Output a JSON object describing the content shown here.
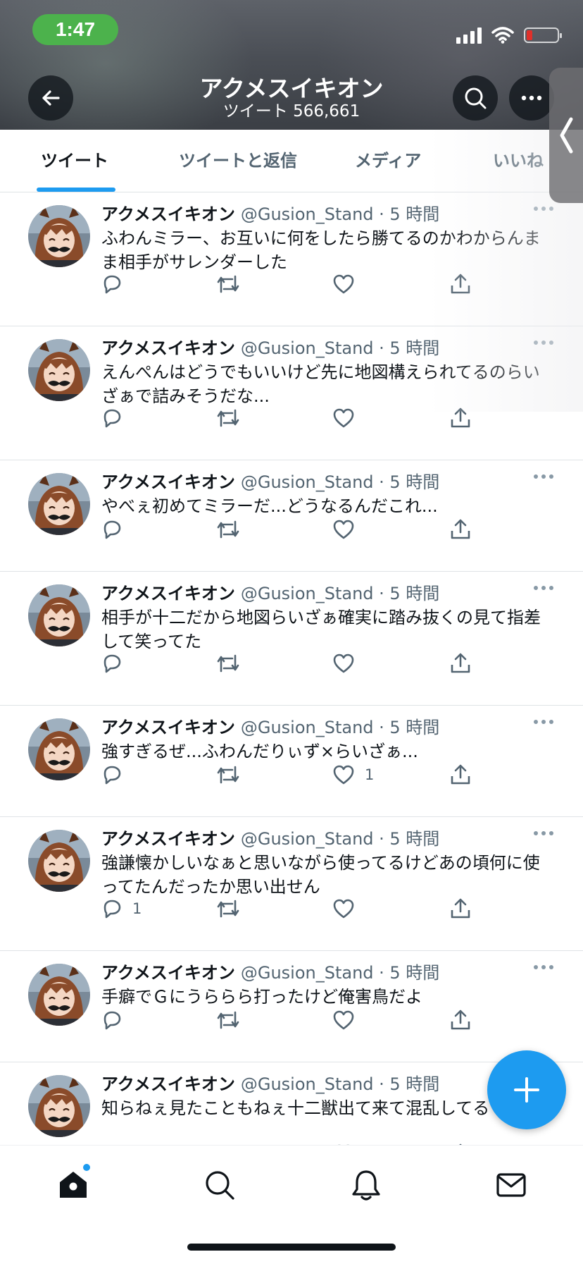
{
  "status_bar": {
    "time": "1:47"
  },
  "header": {
    "title": "アクメスイキオン",
    "subtitle": "ツイート 566,661"
  },
  "tabs": [
    {
      "label": "ツイート",
      "active": true
    },
    {
      "label": "ツイートと返信",
      "active": false
    },
    {
      "label": "メディア",
      "active": false
    },
    {
      "label": "いいね",
      "active": false
    }
  ],
  "tweets": [
    {
      "name": "アクメスイキオン",
      "meta": "@Gusion_Stand · 5 時間",
      "text": "ふわんミラー、お互いに何をしたら勝てるのかわからんまま相手がサレンダーした",
      "reply_count": "",
      "retweet_count": "",
      "like_count": ""
    },
    {
      "name": "アクメスイキオン",
      "meta": "@Gusion_Stand · 5 時間",
      "text": "えんぺんはどうでもいいけど先に地図構えられてるのらいざぁで詰みそうだな...",
      "reply_count": "",
      "retweet_count": "",
      "like_count": ""
    },
    {
      "name": "アクメスイキオン",
      "meta": "@Gusion_Stand · 5 時間",
      "text": "やべぇ初めてミラーだ...どうなるんだこれ...",
      "reply_count": "",
      "retweet_count": "",
      "like_count": ""
    },
    {
      "name": "アクメスイキオン",
      "meta": "@Gusion_Stand · 5 時間",
      "text": "相手が十二だから地図らいざぁ確実に踏み抜くの見て指差して笑ってた",
      "reply_count": "",
      "retweet_count": "",
      "like_count": ""
    },
    {
      "name": "アクメスイキオン",
      "meta": "@Gusion_Stand · 5 時間",
      "text": "強すぎるぜ...ふわんだりぃず×らいざぁ...",
      "reply_count": "",
      "retweet_count": "",
      "like_count": "1"
    },
    {
      "name": "アクメスイキオン",
      "meta": "@Gusion_Stand · 5 時間",
      "text": "強謙懐かしいなぁと思いながら使ってるけどあの頃何に使ってたんだったか思い出せん",
      "reply_count": "1",
      "retweet_count": "",
      "like_count": ""
    },
    {
      "name": "アクメスイキオン",
      "meta": "@Gusion_Stand · 5 時間",
      "text": "手癖でＧにうららら打ったけど俺害鳥だよ",
      "reply_count": "",
      "retweet_count": "",
      "like_count": ""
    },
    {
      "name": "アクメスイキオン",
      "meta": "@Gusion_Stand · 5 時間",
      "text": "知らねぇ見たこともねぇ十二獣出て来て混乱してる",
      "reply_count": "",
      "retweet_count": "",
      "like_count": ""
    }
  ],
  "icons": {
    "back": "arrow-left-icon",
    "search": "search-icon",
    "more": "more-icon",
    "reply": "reply-icon",
    "retweet": "retweet-icon",
    "like": "heart-icon",
    "share": "share-icon",
    "compose": "plus-icon",
    "nav": [
      "home-icon",
      "search-icon",
      "bell-icon",
      "mail-icon"
    ]
  },
  "colors": {
    "accent": "#1d9bf0",
    "time_pill": "#4cb24c",
    "text_primary": "#0f1419",
    "text_secondary": "#536471",
    "battery_low": "#e0302a"
  }
}
